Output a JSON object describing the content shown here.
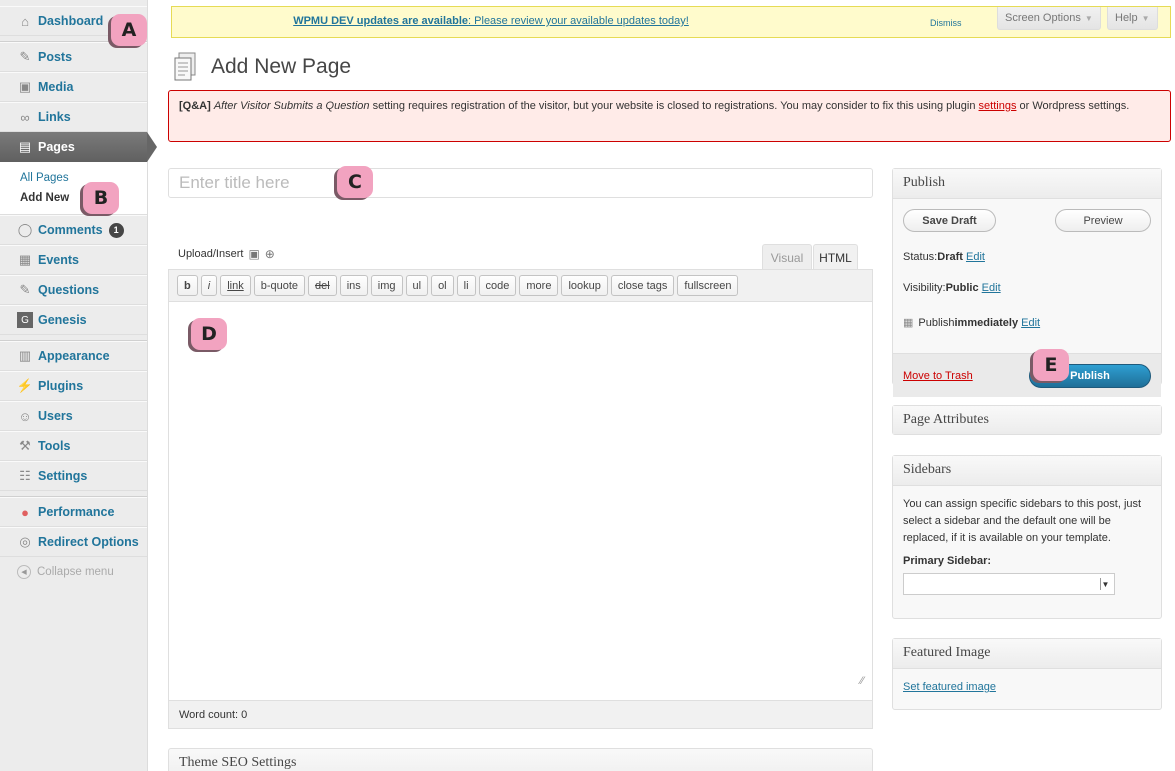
{
  "sidebar": {
    "items": [
      {
        "label": "Dashboard",
        "icon": "home-icon"
      },
      {
        "label": "Posts",
        "icon": "pushpin-icon"
      },
      {
        "label": "Media",
        "icon": "media-icon"
      },
      {
        "label": "Links",
        "icon": "link-icon"
      },
      {
        "label": "Pages",
        "icon": "pages-icon"
      },
      {
        "label": "Comments",
        "icon": "comment-icon",
        "badge": "1"
      },
      {
        "label": "Events",
        "icon": "calendar-icon"
      },
      {
        "label": "Questions",
        "icon": "pushpin-icon"
      },
      {
        "label": "Genesis",
        "icon": "genesis-icon"
      },
      {
        "label": "Appearance",
        "icon": "appearance-icon"
      },
      {
        "label": "Plugins",
        "icon": "plugin-icon"
      },
      {
        "label": "Users",
        "icon": "users-icon"
      },
      {
        "label": "Tools",
        "icon": "tools-icon"
      },
      {
        "label": "Settings",
        "icon": "settings-icon"
      },
      {
        "label": "Performance",
        "icon": "performance-icon"
      },
      {
        "label": "Redirect Options",
        "icon": "redirect-icon"
      }
    ],
    "submenu": [
      "All Pages",
      "Add New"
    ],
    "collapse_label": "Collapse menu"
  },
  "callouts": [
    "A",
    "B",
    "C",
    "D",
    "E"
  ],
  "notice": {
    "bold_text": "WPMU DEV updates are available",
    "rest_text": ": Please review your available updates today!",
    "dismiss": "Dismiss"
  },
  "header_tabs": {
    "screen_options": "Screen Options",
    "help": "Help"
  },
  "page_title": "Add New Page",
  "error": {
    "tag": "[Q&A]",
    "setting": "After Visitor Submits a Question",
    "text1": " setting requires registration of the visitor, but your website is closed to registrations. You may consider to fix this using plugin ",
    "link": "settings",
    "text2": " or Wordpress settings."
  },
  "title_placeholder": "Enter title here",
  "editor": {
    "upload_label": "Upload/Insert",
    "tabs": {
      "visual": "Visual",
      "html": "HTML"
    },
    "buttons": [
      "b",
      "i",
      "link",
      "b-quote",
      "del",
      "ins",
      "img",
      "ul",
      "ol",
      "li",
      "code",
      "more",
      "lookup",
      "close tags",
      "fullscreen"
    ],
    "word_count": "Word count: 0"
  },
  "seo_title": "Theme SEO Settings",
  "publish": {
    "title": "Publish",
    "save_draft": "Save Draft",
    "preview": "Preview",
    "status_label": "Status: ",
    "status_value": "Draft",
    "visibility_label": "Visibility: ",
    "visibility_value": "Public",
    "publish_label": "Publish ",
    "publish_value": "immediately",
    "edit": "Edit",
    "trash": "Move to Trash",
    "publish_button": "Publish"
  },
  "page_attributes_title": "Page Attributes",
  "sidebars_box": {
    "title": "Sidebars",
    "description": "You can assign specific sidebars to this post, just select a sidebar and the default one will be replaced, if it is available on your template.",
    "primary_label": "Primary Sidebar:"
  },
  "featured_image": {
    "title": "Featured Image",
    "link": "Set featured image"
  },
  "colors": {
    "link": "#21759b",
    "publish": "#2e9fd2",
    "callout": "#f2a3c0",
    "error_border": "#cc0000"
  }
}
